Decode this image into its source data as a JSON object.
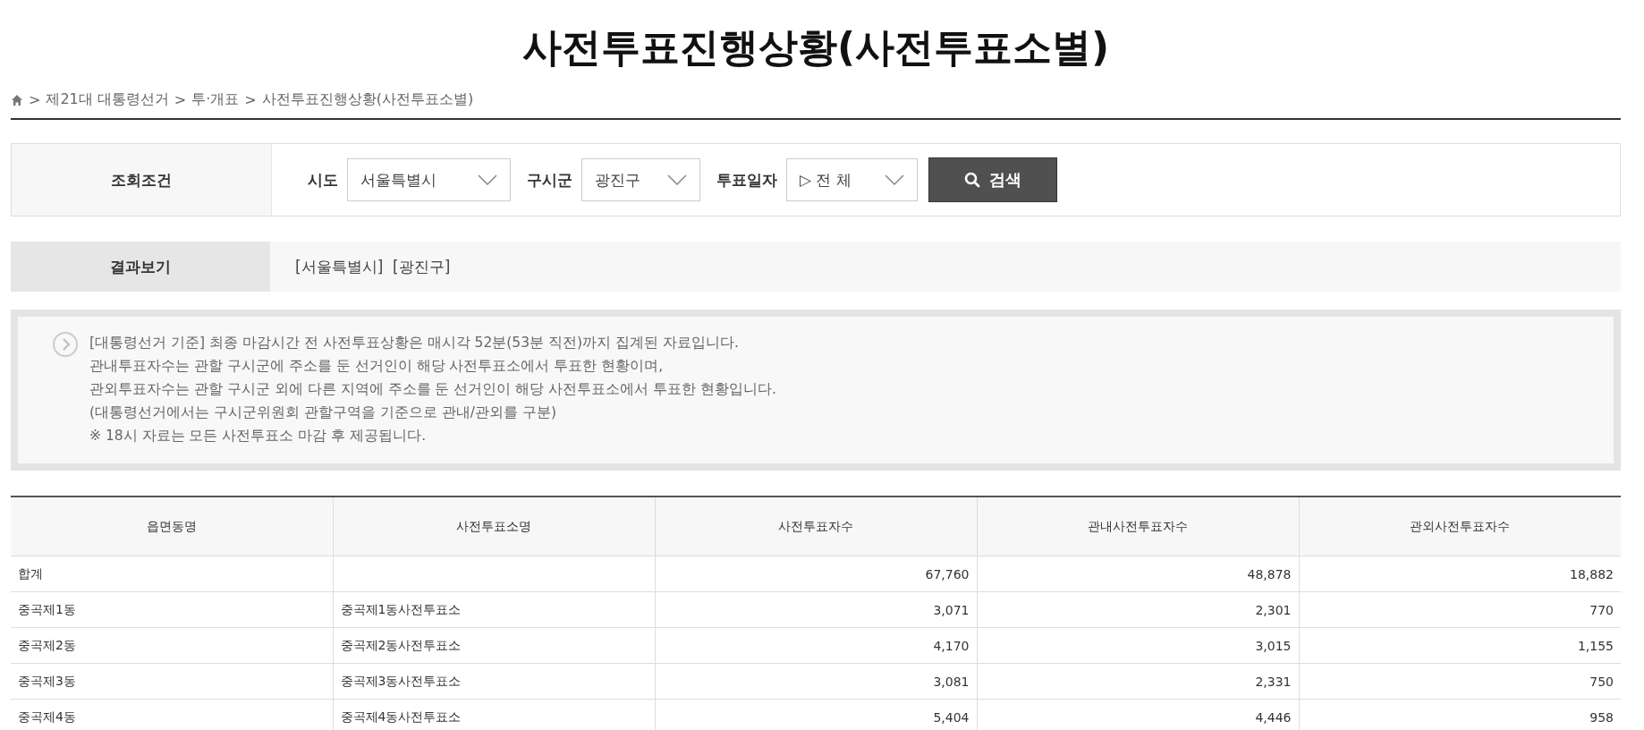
{
  "title": "사전투표진행상황(사전투표소별)",
  "breadcrumb": [
    {
      "separator": ">",
      "label": "제21대 대통령선거"
    },
    {
      "separator": ">",
      "label": "투·개표"
    },
    {
      "separator": ">",
      "label": "사전투표진행상황(사전투표소별)"
    }
  ],
  "search": {
    "label": "조회조건",
    "fields": [
      {
        "label": "시도",
        "value": "서울특별시"
      },
      {
        "label": "구시군",
        "value": "광진구"
      },
      {
        "label": "투표일자",
        "value": "전 체",
        "prefix": "▷"
      }
    ],
    "button": "검색"
  },
  "result": {
    "label": "결과보기",
    "value": "[서울특별시]  [광진구]"
  },
  "notice": [
    "[대통령선거 기준] 최종 마감시간 전 사전투표상황은 매시각 52분(53분 직전)까지 집계된 자료입니다.",
    "관내투표자수는 관할 구시군에 주소를 둔 선거인이 해당 사전투표소에서 투표한 현황이며,",
    "관외투표자수는 관할 구시군 외에 다른 지역에 주소를 둔 선거인이 해당 사전투표소에서 투표한 현황입니다.",
    "(대통령선거에서는 구시군위원회 관할구역을 기준으로 관내/관외를 구분)",
    "※ 18시 자료는 모든 사전투표소 마감 후 제공됩니다."
  ],
  "table": {
    "columns": [
      "읍면동명",
      "사전투표소명",
      "사전투표자수",
      "관내사전투표자수",
      "관외사전투표자수"
    ],
    "rows": [
      [
        "합계",
        "",
        "67,760",
        "48,878",
        "18,882"
      ],
      [
        "중곡제1동",
        "중곡제1동사전투표소",
        "3,071",
        "2,301",
        "770"
      ],
      [
        "중곡제2동",
        "중곡제2동사전투표소",
        "4,170",
        "3,015",
        "1,155"
      ],
      [
        "중곡제3동",
        "중곡제3동사전투표소",
        "3,081",
        "2,331",
        "750"
      ],
      [
        "중곡제4동",
        "중곡제4동사전투표소",
        "5,404",
        "4,446",
        "958"
      ]
    ]
  }
}
